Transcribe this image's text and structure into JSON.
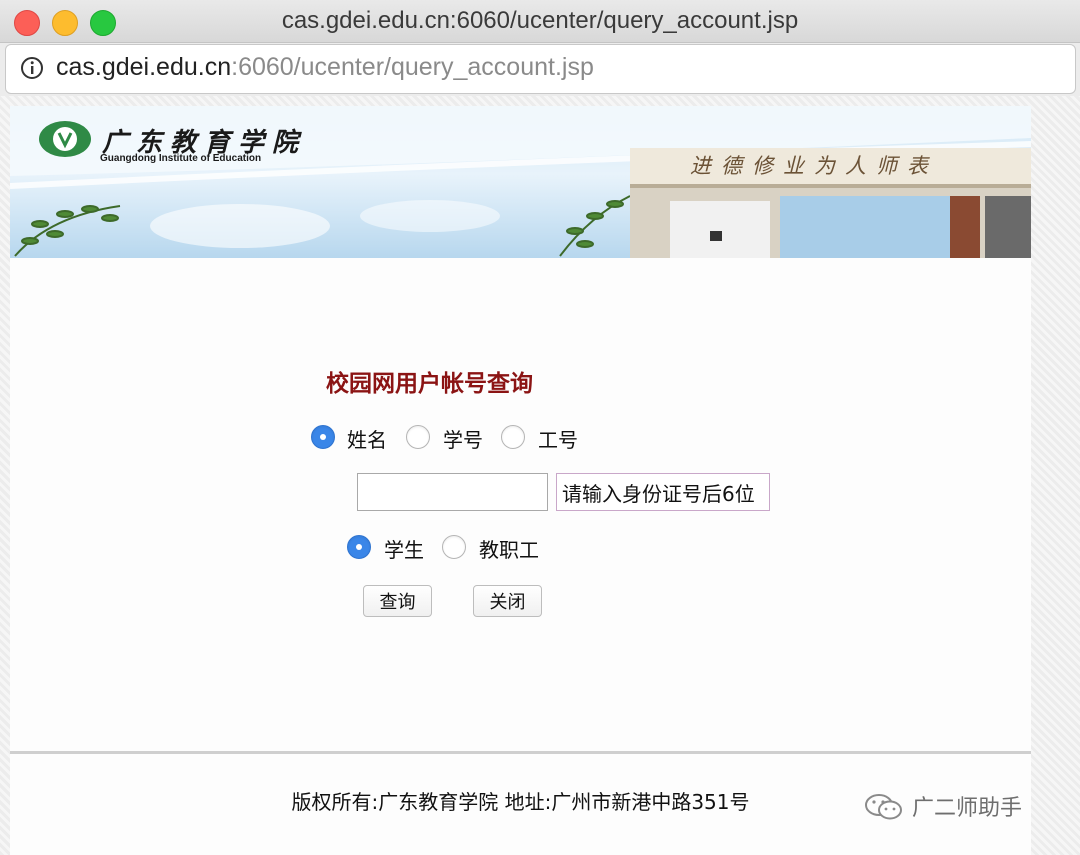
{
  "window": {
    "title": "cas.gdei.edu.cn:6060/ucenter/query_account.jsp"
  },
  "address": {
    "host": "cas.gdei.edu.cn",
    "path": ":6060/ucenter/query_account.jsp"
  },
  "banner": {
    "school_name_cn": "广东教育学院",
    "school_name_en": "Guangdong Institute of Education",
    "motto": "进德修业为人师表"
  },
  "form": {
    "title": "校园网用户帐号查询",
    "query_type": [
      {
        "label": "姓名",
        "checked": true
      },
      {
        "label": "学号",
        "checked": false
      },
      {
        "label": "工号",
        "checked": false
      }
    ],
    "name_input_value": "",
    "id_hint": "请输入身份证号后6位",
    "user_type": [
      {
        "label": "学生",
        "checked": true
      },
      {
        "label": "教职工",
        "checked": false
      }
    ],
    "query_button": "查询",
    "close_button": "关闭"
  },
  "footer": {
    "text": "版权所有:广东教育学院 地址:广州市新港中路351号"
  },
  "watermark": {
    "text": "广二师助手"
  }
}
